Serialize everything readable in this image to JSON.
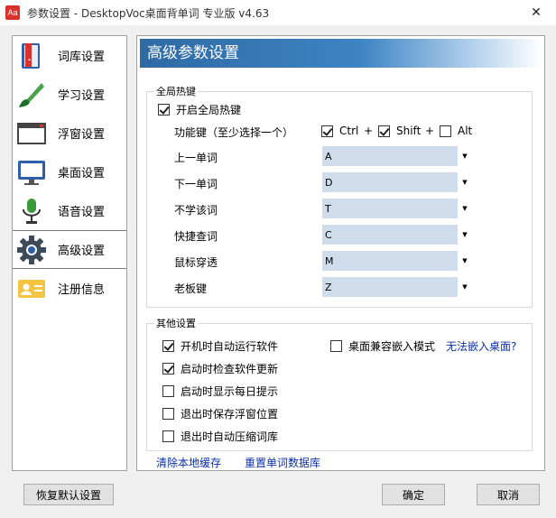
{
  "window": {
    "app_icon": "Aa",
    "title": "参数设置 - DesktopVoc桌面背单词 专业版 v4.63",
    "close_glyph": "✕"
  },
  "sidebar": {
    "items": [
      {
        "label": "词库设置",
        "icon": "book-icon"
      },
      {
        "label": "学习设置",
        "icon": "brush-icon"
      },
      {
        "label": "浮窗设置",
        "icon": "window-icon"
      },
      {
        "label": "桌面设置",
        "icon": "monitor-icon"
      },
      {
        "label": "语音设置",
        "icon": "microphone-icon"
      },
      {
        "label": "高级设置",
        "icon": "gear-icon"
      },
      {
        "label": "注册信息",
        "icon": "id-card-icon"
      }
    ],
    "active": "高级设置"
  },
  "header": {
    "title": "高级参数设置"
  },
  "hotkeys": {
    "legend": "全局热键",
    "enable_label": "开启全局热键",
    "enable_checked": true,
    "modifier_label": "功能键（至少选择一个）",
    "ctrl_label": "Ctrl",
    "ctrl_checked": true,
    "shift_label": "Shift",
    "shift_checked": true,
    "alt_label": "Alt",
    "alt_checked": false,
    "plus": "+",
    "rows": [
      {
        "label": "上一单词",
        "value": "A"
      },
      {
        "label": "下一单词",
        "value": "D"
      },
      {
        "label": "不学该词",
        "value": "T"
      },
      {
        "label": "快捷查词",
        "value": "C"
      },
      {
        "label": "鼠标穿透",
        "value": "M"
      },
      {
        "label": "老板键",
        "value": "Z"
      }
    ]
  },
  "other": {
    "legend": "其他设置",
    "options": [
      {
        "label": "开机时自动运行软件",
        "checked": true
      },
      {
        "label": "启动时检查软件更新",
        "checked": true
      },
      {
        "label": "启动时显示每日提示",
        "checked": false
      },
      {
        "label": "退出时保存浮窗位置",
        "checked": false
      },
      {
        "label": "退出时自动压缩词库",
        "checked": false
      }
    ],
    "embed_label": "桌面兼容嵌入模式",
    "embed_checked": false,
    "embed_link": "无法嵌入桌面?"
  },
  "links": {
    "clear_cache": "清除本地缓存",
    "reset_db": "重置单词数据库"
  },
  "buttons": {
    "restore": "恢复默认设置",
    "ok": "确定",
    "cancel": "取消"
  },
  "colors": {
    "header_start": "#2f6aa3",
    "combo_bg": "#cfdcec",
    "link": "#0b2fa8"
  }
}
